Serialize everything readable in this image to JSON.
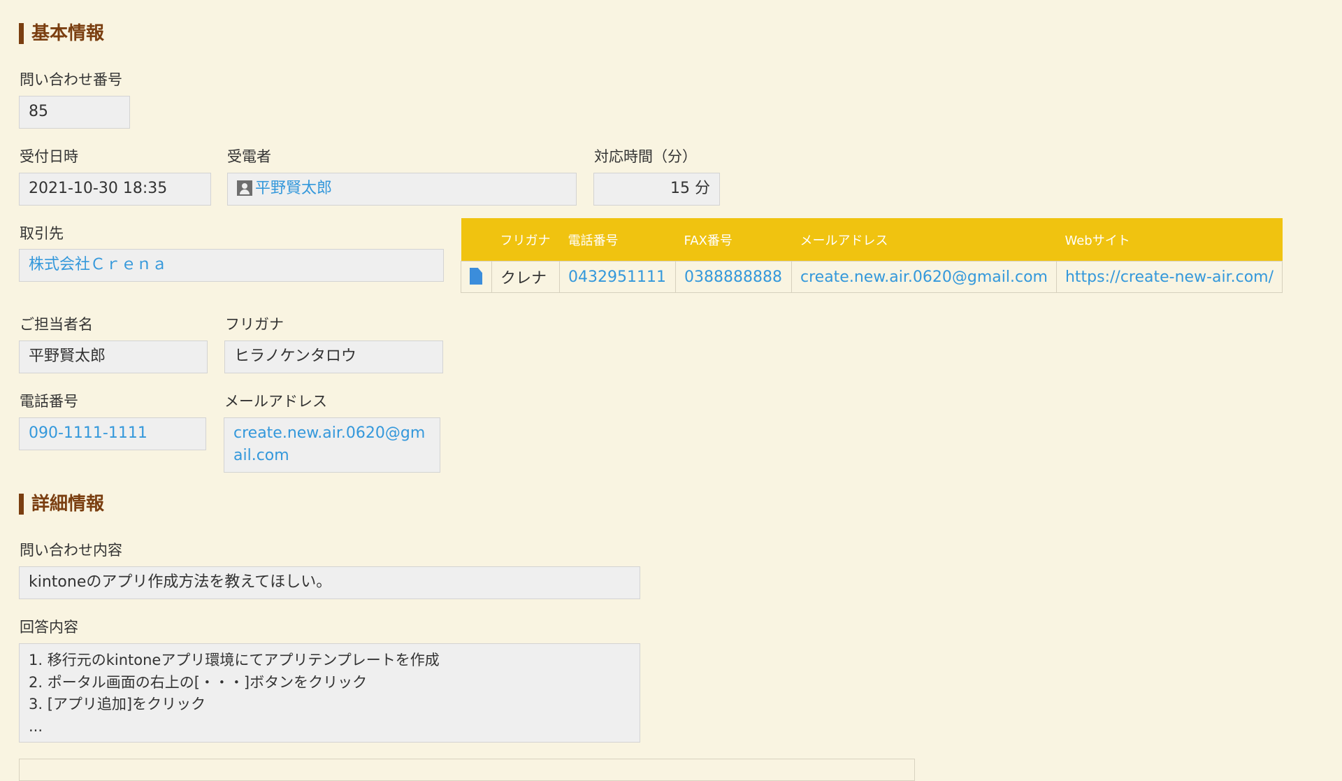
{
  "basic": {
    "section_title": "基本情報",
    "inquiry_number_label": "問い合わせ番号",
    "inquiry_number": "85",
    "received_at_label": "受付日時",
    "received_at": "2021-10-30 18:35",
    "receiver_label": "受電者",
    "receiver": "平野賢太郎",
    "duration_label": "対応時間（分）",
    "duration": "15 分",
    "client_label": "取引先",
    "client": "株式会社Ｃｒｅｎａ",
    "contact_name_label": "ご担当者名",
    "contact_name": "平野賢太郎",
    "furigana_label": "フリガナ",
    "furigana": "ヒラノケンタロウ",
    "phone_label": "電話番号",
    "phone": "090-1111-1111",
    "email_label": "メールアドレス",
    "email": "create.new.air.0620@gmail.com"
  },
  "related_table": {
    "headers": [
      "",
      "フリガナ",
      "電話番号",
      "FAX番号",
      "メールアドレス",
      "Webサイト"
    ],
    "row": {
      "icon": "document-icon",
      "furigana": "クレナ",
      "phone": "0432951111",
      "fax": "0388888888",
      "email": "create.new.air.0620@gmail.com",
      "website": "https://create-new-air.com/"
    }
  },
  "detail": {
    "section_title": "詳細情報",
    "inquiry_content_label": "問い合わせ内容",
    "inquiry_content": "kintoneのアプリ作成方法を教えてほしい。",
    "answer_label": "回答内容",
    "answer_lines": [
      "1. 移行元のkintoneアプリ環境にてアプリテンプレートを作成",
      "2. ポータル画面の右上の[・・・]ボタンをクリック",
      "3. [アプリ追加]をクリック",
      "..."
    ]
  },
  "colors": {
    "background": "#f9f4e1",
    "accent_brown": "#7a3e10",
    "table_header": "#f0c310",
    "link": "#3498db"
  }
}
